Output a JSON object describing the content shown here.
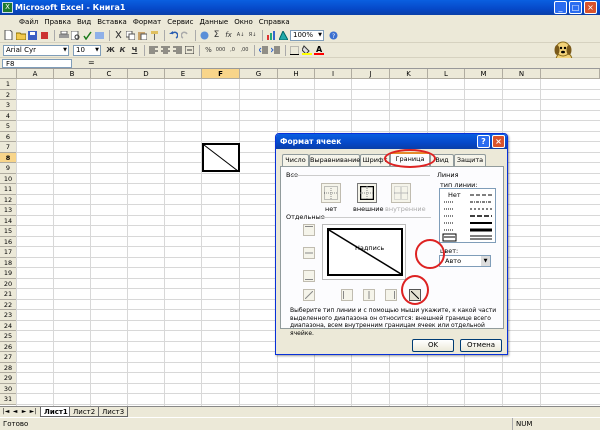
{
  "window": {
    "title": "Microsoft Excel - Книга1",
    "app_icon": "X",
    "minimize": "_",
    "maximize": "□",
    "close": "×"
  },
  "menu": [
    "Файл",
    "Правка",
    "Вид",
    "Вставка",
    "Формат",
    "Сервис",
    "Данные",
    "Окно",
    "Справка"
  ],
  "toolbar": {
    "zoom": "100%"
  },
  "format_toolbar": {
    "font": "Arial Cyr",
    "size": "10",
    "bold": "Ж",
    "italic": "К",
    "underline": "Ч",
    "currency": "%",
    "thousands": "000",
    "inc_decimals": ",0",
    "fill_color": "#FFFF00",
    "font_color": "#FF0000",
    "font_color_letter": "A"
  },
  "formula_bar": {
    "name_box": "F8",
    "equals": "="
  },
  "columns": [
    "A",
    "B",
    "C",
    "D",
    "E",
    "F",
    "G",
    "H",
    "I",
    "J",
    "K",
    "L",
    "M",
    "N"
  ],
  "rows": [
    "1",
    "2",
    "3",
    "4",
    "5",
    "6",
    "7",
    "8",
    "9",
    "10",
    "11",
    "12",
    "13",
    "14",
    "15",
    "16",
    "17",
    "18",
    "19",
    "20",
    "21",
    "22",
    "23",
    "24",
    "25",
    "26",
    "27",
    "28",
    "29",
    "30",
    "31"
  ],
  "active_cell": {
    "column": "F",
    "row": "8"
  },
  "sheet_tabs": [
    "Лист1",
    "Лист2",
    "Лист3"
  ],
  "status": {
    "left": "Готово",
    "right": "NUM"
  },
  "dialog": {
    "title": "Формат ячеек",
    "help": "?",
    "close": "×",
    "tabs": [
      "Число",
      "Выравнивание",
      "Шрифт",
      "Граница",
      "Вид",
      "Защита"
    ],
    "active_tab": "Граница",
    "group_all": "Все",
    "presets": [
      "нет",
      "внешние",
      "внутренние"
    ],
    "group_individual": "Отдельные",
    "preview_text": "Надпись",
    "group_line": "Линия",
    "line_type_label": "тип линии:",
    "line_none": "Нет",
    "color_label": "цвет:",
    "color_value": "Авто",
    "hint": "Выберите тип линии и с помощью мыши укажите, к какой части выделенного диапазона он относится: внешней границе всего диапазона, всем внутренним границам ячеек или отдельной ячейке.",
    "ok": "OK",
    "cancel": "Отмена"
  },
  "highlight_color": "#DD2222"
}
